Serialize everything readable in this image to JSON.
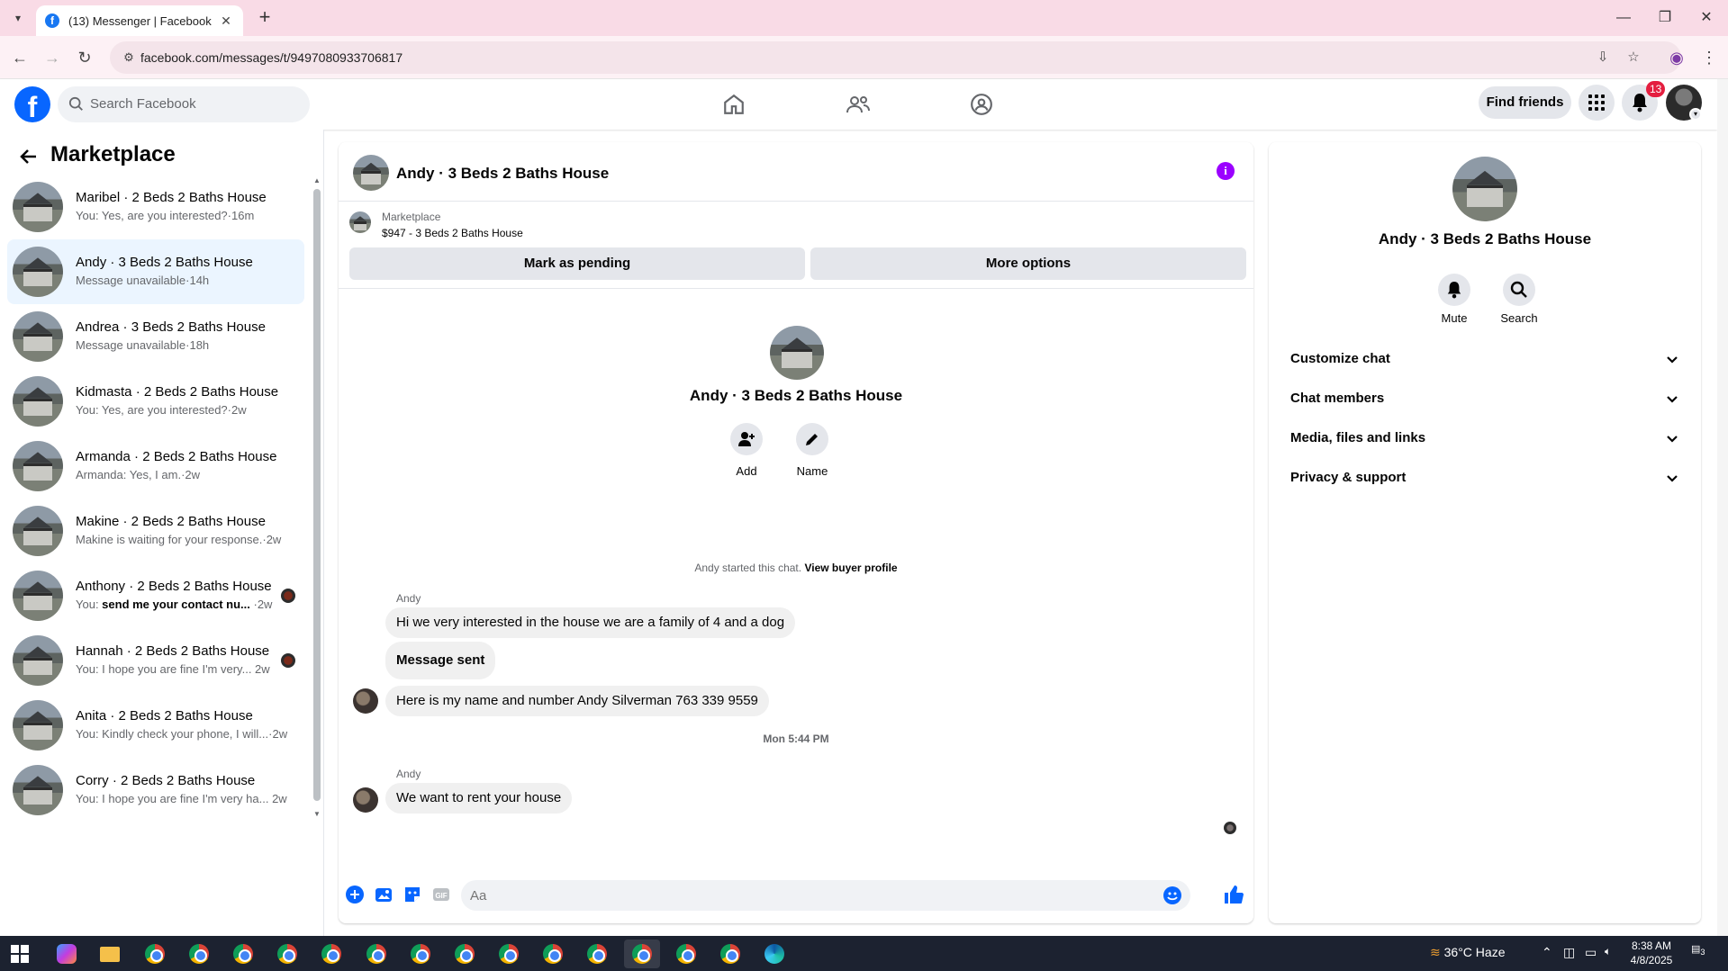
{
  "browser": {
    "tab_title": "(13) Messenger | Facebook",
    "url": "facebook.com/messages/t/9497080933706817"
  },
  "header": {
    "search_placeholder": "Search Facebook",
    "find_friends": "Find friends",
    "notification_count": "13",
    "logo_letter": "f"
  },
  "sidebar": {
    "title": "Marketplace",
    "conversations": [
      {
        "name": "Maribel · 2 Beds 2 Baths House",
        "sub": "You: Yes, are you interested?·16m",
        "active": false
      },
      {
        "name": "Andy · 3 Beds 2 Baths House",
        "sub": "Message unavailable·14h",
        "active": true
      },
      {
        "name": "Andrea · 3 Beds 2 Baths House",
        "sub": "Message unavailable·18h",
        "active": false
      },
      {
        "name": "Kidmasta · 2 Beds 2 Baths House",
        "sub": "You: Yes, are you interested?·2w",
        "active": false
      },
      {
        "name": "Armanda · 2 Beds 2 Baths House",
        "sub": "Armanda: Yes, I am.·2w",
        "active": false
      },
      {
        "name": "Makine · 2 Beds 2 Baths House",
        "sub": "Makine is waiting for your response.·2w",
        "active": false
      },
      {
        "name": "Anthony · 2 Beds 2 Baths House",
        "sub_prefix": "You: ",
        "sub_bold": "send me your contact nu...",
        "sub_suffix": " ·2w",
        "seen": true
      },
      {
        "name": "Hannah · 2 Beds 2 Baths House",
        "sub": "You: I hope you are fine I'm very...  2w",
        "seen": true
      },
      {
        "name": "Anita · 2 Beds 2 Baths House",
        "sub": "You: Kindly check your phone, I will...·2w",
        "active": false
      },
      {
        "name": "Corry · 2 Beds 2 Baths House",
        "sub": "You: I hope you are fine I'm very ha...  2w",
        "active": false
      }
    ]
  },
  "chat": {
    "title": "Andy · 3 Beds 2 Baths House",
    "marketplace_label": "Marketplace",
    "listing": "$947 - 3 Beds 2 Baths House",
    "mark_pending": "Mark as pending",
    "more_options": "More options",
    "intro_title": "Andy · 3 Beds 2 Baths House",
    "add_label": "Add",
    "name_label": "Name",
    "started_text": "Andy started this chat.",
    "view_profile": "View buyer profile",
    "sender1": "Andy",
    "msg1": "Hi we very interested in the house we are a family of 4 and a dog",
    "msg2": "Message sent",
    "msg3": "Here is my name and number Andy Silverman 763 339 9559",
    "timestamp": "Mon 5:44 PM",
    "sender2": "Andy",
    "msg4": "We want to rent your house",
    "composer_placeholder": "Aa"
  },
  "info_panel": {
    "title": "Andy · 3 Beds 2 Baths House",
    "mute": "Mute",
    "search": "Search",
    "rows": [
      "Customize chat",
      "Chat members",
      "Media, files and links",
      "Privacy & support"
    ]
  },
  "taskbar": {
    "weather": "36°C  Haze",
    "time": "8:38 AM",
    "date": "4/8/2025",
    "notif_count": "3"
  },
  "colors": {
    "brand": "#0866ff",
    "messenger_accent": "#9b00ff",
    "active_conversation": "#ebf5ff",
    "notification_badge": "#e41e3f"
  }
}
